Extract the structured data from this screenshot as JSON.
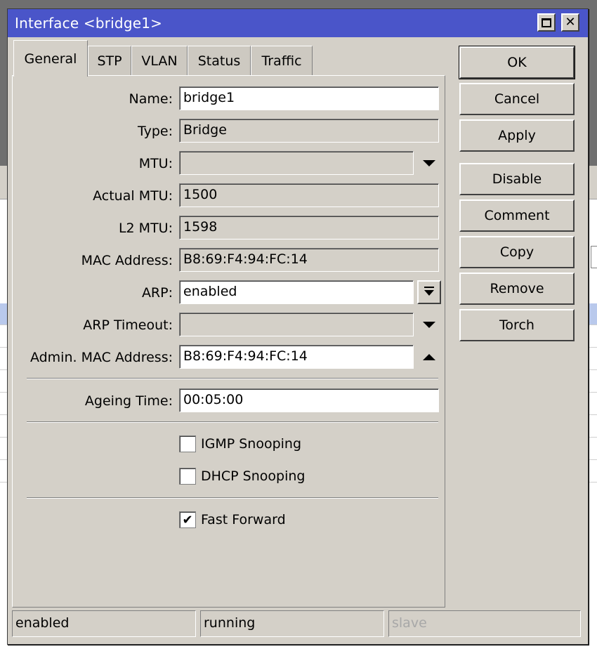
{
  "window": {
    "title": "Interface <bridge1>"
  },
  "tabs": [
    {
      "label": "General"
    },
    {
      "label": "STP"
    },
    {
      "label": "VLAN"
    },
    {
      "label": "Status"
    },
    {
      "label": "Traffic"
    }
  ],
  "form": {
    "name": {
      "label": "Name:",
      "value": "bridge1"
    },
    "type": {
      "label": "Type:",
      "value": "Bridge"
    },
    "mtu": {
      "label": "MTU:",
      "value": ""
    },
    "actual_mtu": {
      "label": "Actual MTU:",
      "value": "1500"
    },
    "l2_mtu": {
      "label": "L2 MTU:",
      "value": "1598"
    },
    "mac_address": {
      "label": "MAC Address:",
      "value": "B8:69:F4:94:FC:14"
    },
    "arp": {
      "label": "ARP:",
      "value": "enabled"
    },
    "arp_timeout": {
      "label": "ARP Timeout:",
      "value": ""
    },
    "admin_mac": {
      "label": "Admin. MAC Address:",
      "value": "B8:69:F4:94:FC:14"
    },
    "ageing_time": {
      "label": "Ageing Time:",
      "value": "00:05:00"
    },
    "igmp_snooping": {
      "label": "IGMP Snooping",
      "checked": false
    },
    "dhcp_snooping": {
      "label": "DHCP Snooping",
      "checked": false
    },
    "fast_forward": {
      "label": "Fast Forward",
      "checked": true,
      "mark": "✔"
    }
  },
  "buttons": {
    "ok": "OK",
    "cancel": "Cancel",
    "apply": "Apply",
    "disable": "Disable",
    "comment": "Comment",
    "copy": "Copy",
    "remove": "Remove",
    "torch": "Torch"
  },
  "statusbar": {
    "state": "enabled",
    "running": "running",
    "slave": "slave"
  },
  "colors": {
    "titlebar": "#4a55c9",
    "window_bg": "#d4d0c8"
  }
}
